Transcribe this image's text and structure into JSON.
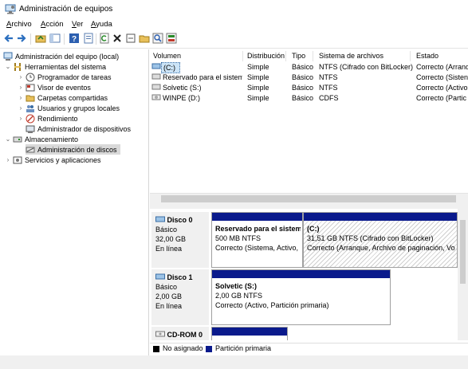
{
  "window": {
    "title": "Administración de equipos"
  },
  "menu": [
    "Archivo",
    "Acción",
    "Ver",
    "Ayuda"
  ],
  "toolbar_icons": [
    "back-icon",
    "forward-icon",
    "up-folder-icon",
    "show-pane-icon",
    "help-icon",
    "properties-icon",
    "refresh-icon",
    "delete-icon",
    "open-icon",
    "folder-icon",
    "search-icon",
    "settings-icon"
  ],
  "tree": {
    "root": "Administración del equipo (local)",
    "tools": "Herramientas del sistema",
    "scheduler": "Programador de tareas",
    "event_viewer": "Visor de eventos",
    "shared_folders": "Carpetas compartidas",
    "users_groups": "Usuarios y grupos locales",
    "performance": "Rendimiento",
    "device_manager": "Administrador de dispositivos",
    "storage": "Almacenamiento",
    "disk_mgmt": "Administración de discos",
    "services": "Servicios y aplicaciones"
  },
  "volumes": {
    "headers": [
      "Volumen",
      "Distribución",
      "Tipo",
      "Sistema de archivos",
      "Estado"
    ],
    "rows": [
      [
        "(C:)",
        "Simple",
        "Básico",
        "NTFS (Cifrado con BitLocker)",
        "Correcto (Arranq"
      ],
      [
        "Reservado para el sistema",
        "Simple",
        "Básico",
        "NTFS",
        "Correcto (Sisten"
      ],
      [
        "Solvetic (S:)",
        "Simple",
        "Básico",
        "NTFS",
        "Correcto (Activo"
      ],
      [
        "WINPE (D:)",
        "Simple",
        "Básico",
        "CDFS",
        "Correcto (Partic"
      ]
    ]
  },
  "disks": {
    "d0": {
      "name": "Disco 0",
      "type": "Básico",
      "size": "32,00 GB",
      "status": "En línea"
    },
    "d0p1": {
      "name": "Reservado para el sistem",
      "size": "500 MB NTFS",
      "status": "Correcto (Sistema, Activo,"
    },
    "d0p2": {
      "name": "(C:)",
      "size": "31,51 GB NTFS (Cifrado con BitLocker)",
      "status": "Correcto (Arranque, Archivo de paginación, Vo"
    },
    "d1": {
      "name": "Disco 1",
      "type": "Básico",
      "size": "2,00 GB",
      "status": "En línea"
    },
    "d1p1": {
      "name": "Solvetic  (S:)",
      "size": "2,00 GB NTFS",
      "status": "Correcto (Activo, Partición primaria)"
    },
    "cd": {
      "name": "CD-ROM 0"
    }
  },
  "legend": {
    "unallocated": "No asignado",
    "primary": "Partición primaria",
    "unallocated_color": "#000000",
    "primary_color": "#0a1a8c"
  }
}
